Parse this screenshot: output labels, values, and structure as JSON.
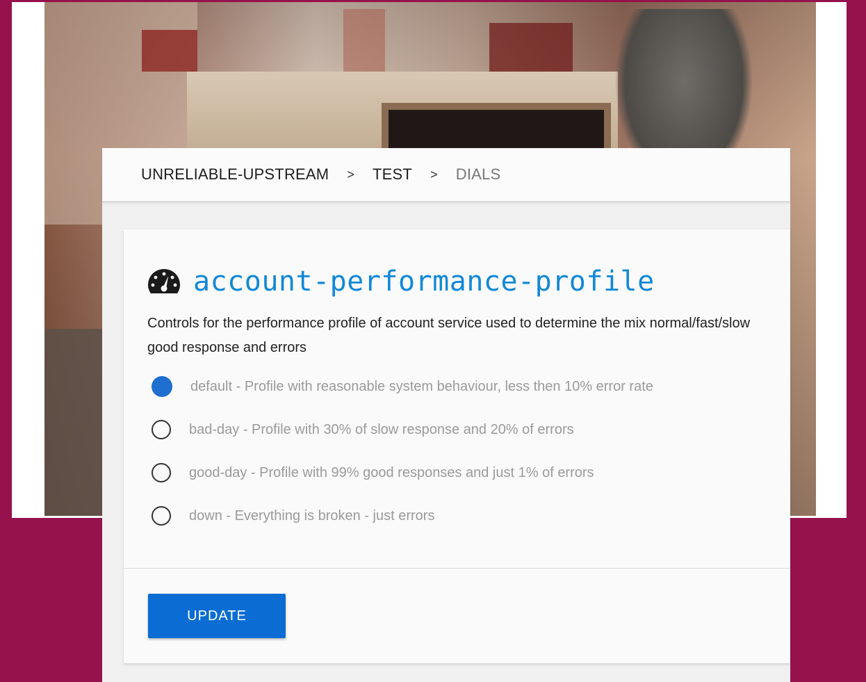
{
  "breadcrumb": {
    "items": [
      "UNRELIABLE-UPSTREAM",
      "TEST",
      "DIALS"
    ],
    "separator": ">"
  },
  "card": {
    "icon": "speedometer-icon",
    "title": "account-performance-profile",
    "description": "Controls for the performance profile of account service used to determine the mix normal/fast/slow good response and errors",
    "options": [
      {
        "label": "default - Profile with reasonable system behaviour, less then 10% error rate",
        "selected": true
      },
      {
        "label": "bad-day - Profile with 30% of slow response and 20% of errors",
        "selected": false
      },
      {
        "label": "good-day - Profile with 99% good responses and just 1% of errors",
        "selected": false
      },
      {
        "label": "down - Everything is broken - just errors",
        "selected": false
      }
    ],
    "submit_label": "UPDATE"
  },
  "colors": {
    "accent": "#0b6dd3",
    "title": "#1188d8",
    "background": "#95124d"
  }
}
